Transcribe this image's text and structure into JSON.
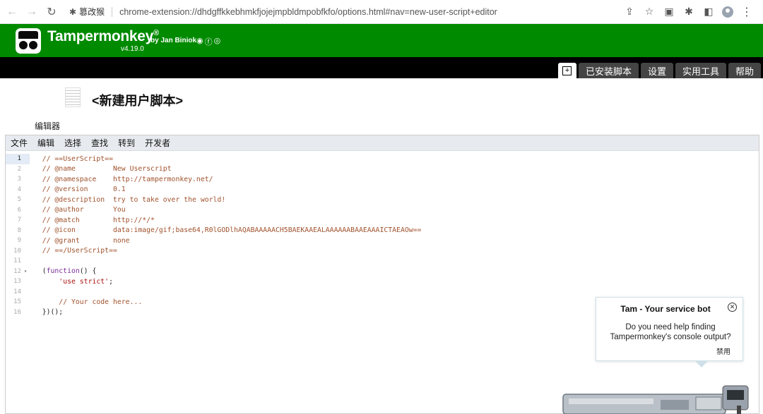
{
  "browser": {
    "origin_label": "篡改猴",
    "url": "chrome-extension://dhdgffkkebhmkfjojejmpbldmpobfkfo/options.html#nav=new-user-script+editor"
  },
  "header": {
    "title": "Tampermonkey",
    "reg": "®",
    "byline": "by Jan Biniok",
    "version": "v4.19.0"
  },
  "tabs": [
    "已安装脚本",
    "设置",
    "实用工具",
    "帮助"
  ],
  "script": {
    "title": "<新建用户脚本>"
  },
  "editor": {
    "label": "编辑器",
    "menu": [
      "文件",
      "编辑",
      "选择",
      "查找",
      "转到",
      "开发者"
    ]
  },
  "bot": {
    "title": "Tam - Your service bot",
    "message": "Do you need help finding Tampermonkey's console output?",
    "disable": "禁用"
  },
  "colors": {
    "header_green": "#008a00",
    "tab_gray": "#444444"
  }
}
